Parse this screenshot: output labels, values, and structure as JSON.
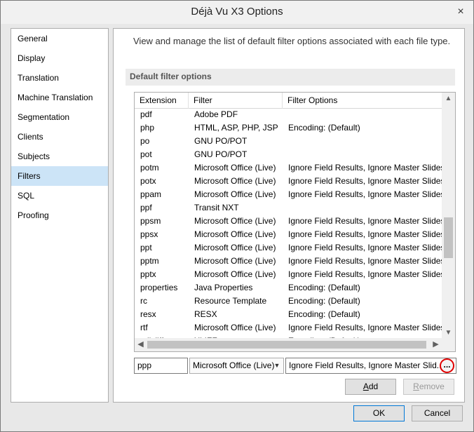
{
  "window": {
    "title": "Déjà Vu X3 Options",
    "close_glyph": "×"
  },
  "nav": {
    "selected_index": 7,
    "items": [
      {
        "label": "General"
      },
      {
        "label": "Display"
      },
      {
        "label": "Translation"
      },
      {
        "label": "Machine Translation"
      },
      {
        "label": "Segmentation"
      },
      {
        "label": "Clients"
      },
      {
        "label": "Subjects"
      },
      {
        "label": "Filters"
      },
      {
        "label": "SQL"
      },
      {
        "label": "Proofing"
      }
    ]
  },
  "panel": {
    "description": "View and manage the list of default filter options associated with each file type.",
    "section_title": "Default filter options"
  },
  "grid": {
    "columns": {
      "extension": "Extension",
      "filter": "Filter",
      "options": "Filter Options"
    },
    "rows": [
      {
        "ext": "pdf",
        "filter": "Adobe PDF",
        "options": ""
      },
      {
        "ext": "php",
        "filter": "HTML, ASP, PHP, JSP",
        "options": "Encoding: (Default)"
      },
      {
        "ext": "po",
        "filter": "GNU PO/POT",
        "options": ""
      },
      {
        "ext": "pot",
        "filter": "GNU PO/POT",
        "options": ""
      },
      {
        "ext": "potm",
        "filter": "Microsoft Office (Live)",
        "options": "Ignore Field Results, Ignore Master Slides,"
      },
      {
        "ext": "potx",
        "filter": "Microsoft Office (Live)",
        "options": "Ignore Field Results, Ignore Master Slides,"
      },
      {
        "ext": "ppam",
        "filter": "Microsoft Office (Live)",
        "options": "Ignore Field Results, Ignore Master Slides,"
      },
      {
        "ext": "ppf",
        "filter": "Transit NXT",
        "options": ""
      },
      {
        "ext": "ppsm",
        "filter": "Microsoft Office (Live)",
        "options": "Ignore Field Results, Ignore Master Slides,"
      },
      {
        "ext": "ppsx",
        "filter": "Microsoft Office (Live)",
        "options": "Ignore Field Results, Ignore Master Slides,"
      },
      {
        "ext": "ppt",
        "filter": "Microsoft Office (Live)",
        "options": "Ignore Field Results, Ignore Master Slides,"
      },
      {
        "ext": "pptm",
        "filter": "Microsoft Office (Live)",
        "options": "Ignore Field Results, Ignore Master Slides,"
      },
      {
        "ext": "pptx",
        "filter": "Microsoft Office (Live)",
        "options": "Ignore Field Results, Ignore Master Slides,"
      },
      {
        "ext": "properties",
        "filter": "Java Properties",
        "options": "Encoding: (Default)"
      },
      {
        "ext": "rc",
        "filter": "Resource Template",
        "options": "Encoding: (Default)"
      },
      {
        "ext": "resx",
        "filter": "RESX",
        "options": "Encoding: (Default)"
      },
      {
        "ext": "rtf",
        "filter": "Microsoft Office (Live)",
        "options": "Ignore Field Results, Ignore Master Slides,"
      },
      {
        "ext": "sdlxliff",
        "filter": "XLIFF",
        "options": "Encoding: (Default)"
      }
    ]
  },
  "editor": {
    "extension_value": "ppp",
    "filter_value": "Microsoft Office (Live)",
    "options_value": "Ignore Field Results, Ignore Master Slid...",
    "browse_label": "..."
  },
  "buttons": {
    "add": {
      "label": "Add",
      "accel": "A",
      "rest": "dd"
    },
    "remove": {
      "label": "Remove",
      "accel": "R",
      "rest": "emove",
      "disabled": true
    },
    "ok": "OK",
    "cancel": "Cancel"
  },
  "icons": {
    "scroll_up": "▲",
    "scroll_down": "▼",
    "scroll_left": "◀",
    "scroll_right": "▶",
    "dropdown": "▼"
  },
  "colors": {
    "selection": "#cce4f7",
    "highlight_circle": "#e00000"
  }
}
